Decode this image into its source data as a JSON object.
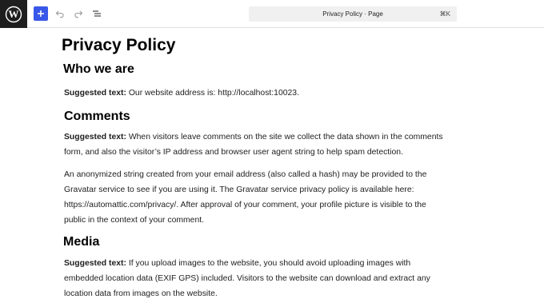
{
  "toolbar": {
    "logo_icon": "wordpress-logo-icon",
    "add_icon": "plus-icon",
    "undo_icon": "undo-icon",
    "redo_icon": "redo-icon",
    "document_overview_icon": "list-view-icon",
    "command_bar": {
      "title": "Privacy Policy · Page",
      "shortcut": "⌘K"
    }
  },
  "content": {
    "page_title": "Privacy Policy",
    "sections": [
      {
        "heading": "Who we are",
        "paragraphs": [
          {
            "label": "Suggested text:",
            "text": " Our website address is: http://localhost:10023."
          }
        ]
      },
      {
        "heading": "Comments",
        "paragraphs": [
          {
            "label": "Suggested text:",
            "text": " When visitors leave comments on the site we collect the data shown in the comments form, and also the visitor’s IP address and browser user agent string to help spam detection."
          },
          {
            "label": "",
            "text": "An anonymized string created from your email address (also called a hash) may be provided to the Gravatar service to see if you are using it. The Gravatar service privacy policy is available here: https://automattic.com/privacy/. After approval of your comment, your profile picture is visible to the public in the context of your comment."
          }
        ]
      },
      {
        "heading": "Media",
        "paragraphs": [
          {
            "label": "Suggested text:",
            "text": " If you upload images to the website, you should avoid uploading images with embedded location data (EXIF GPS) included. Visitors to the website can download and extract any location data from images on the website."
          }
        ]
      }
    ]
  },
  "colors": {
    "accent": "#3858e9",
    "logo_bg": "#1e1e1e",
    "command_bar_bg": "#f0f0f0"
  }
}
